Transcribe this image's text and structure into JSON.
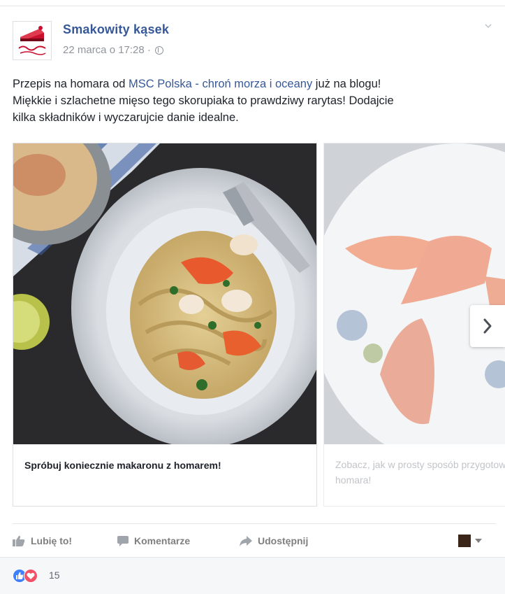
{
  "post": {
    "author": "Smakowity kąsek",
    "timestamp": "22 marca o 17:28 ·",
    "text": {
      "part1": "Przepis na homara od ",
      "link1": "MSC Polska - chroń morza i oceany",
      "part2": " już na blogu!",
      "line2": "Miękkie i szlachetne mięso tego skorupiaka to prawdziwy rarytas! Dodajcie",
      "line3": "kilka składników i wyczarujcie danie idealne."
    }
  },
  "carousel": {
    "cards": [
      {
        "title": "Spróbuj koniecznie makaronu z homarem!"
      },
      {
        "title": "Zobacz, jak w prosty sposób przygotować homara!"
      }
    ]
  },
  "actions": {
    "like": "Lubię to!",
    "comment": "Komentarze",
    "share": "Udostępnij"
  },
  "reactions": {
    "count": "15"
  },
  "colors": {
    "link": "#365899",
    "meta": "#90949c",
    "like_blue": "#4080ff",
    "love_red": "#f25268"
  }
}
